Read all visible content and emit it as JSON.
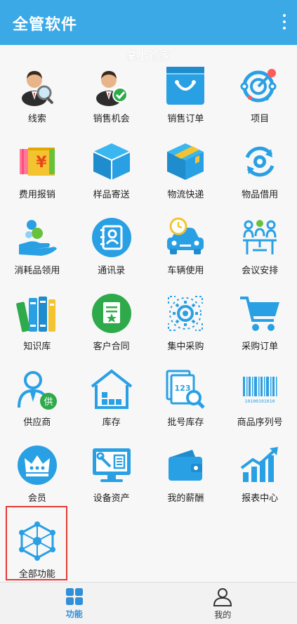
{
  "appbar": {
    "title": "全管软件",
    "menu_icon": "more-vert-icon"
  },
  "ghost_heading": "掌上管家",
  "colors": {
    "primary": "#3aa9e6",
    "tab_active": "#2f8fd8",
    "highlight": "#e53935"
  },
  "features": [
    {
      "label": "线索",
      "icon": "person-search-icon"
    },
    {
      "label": "销售机会",
      "icon": "person-check-icon"
    },
    {
      "label": "销售订单",
      "icon": "shopping-bag-icon"
    },
    {
      "label": "项目",
      "icon": "project-network-icon"
    },
    {
      "label": "费用报销",
      "icon": "expense-card-icon"
    },
    {
      "label": "样品寄送",
      "icon": "box-icon"
    },
    {
      "label": "物流快递",
      "icon": "package-icon"
    },
    {
      "label": "物品借用",
      "icon": "sync-gear-icon"
    },
    {
      "label": "消耗品领用",
      "icon": "hand-coins-icon"
    },
    {
      "label": "通讯录",
      "icon": "address-book-icon"
    },
    {
      "label": "车辆使用",
      "icon": "car-clock-icon"
    },
    {
      "label": "会议安排",
      "icon": "meeting-icon"
    },
    {
      "label": "知识库",
      "icon": "books-icon"
    },
    {
      "label": "客户合同",
      "icon": "contract-icon"
    },
    {
      "label": "集中采购",
      "icon": "central-gear-icon"
    },
    {
      "label": "采购订单",
      "icon": "cart-icon"
    },
    {
      "label": "供应商",
      "icon": "supplier-icon"
    },
    {
      "label": "库存",
      "icon": "warehouse-icon"
    },
    {
      "label": "批号库存",
      "icon": "batch-search-icon"
    },
    {
      "label": "商品序列号",
      "icon": "barcode-icon"
    },
    {
      "label": "会员",
      "icon": "crown-icon"
    },
    {
      "label": "设备资产",
      "icon": "monitor-tools-icon"
    },
    {
      "label": "我的薪酬",
      "icon": "wallet-icon"
    },
    {
      "label": "报表中心",
      "icon": "bar-chart-icon"
    },
    {
      "label": "全部功能",
      "icon": "all-functions-icon"
    }
  ],
  "barcode_digits": "10100101010",
  "batch_number": "123",
  "supplier_badge": "供",
  "tabs": [
    {
      "label": "功能",
      "icon": "grid-icon",
      "active": true
    },
    {
      "label": "我的",
      "icon": "user-icon",
      "active": false
    }
  ]
}
